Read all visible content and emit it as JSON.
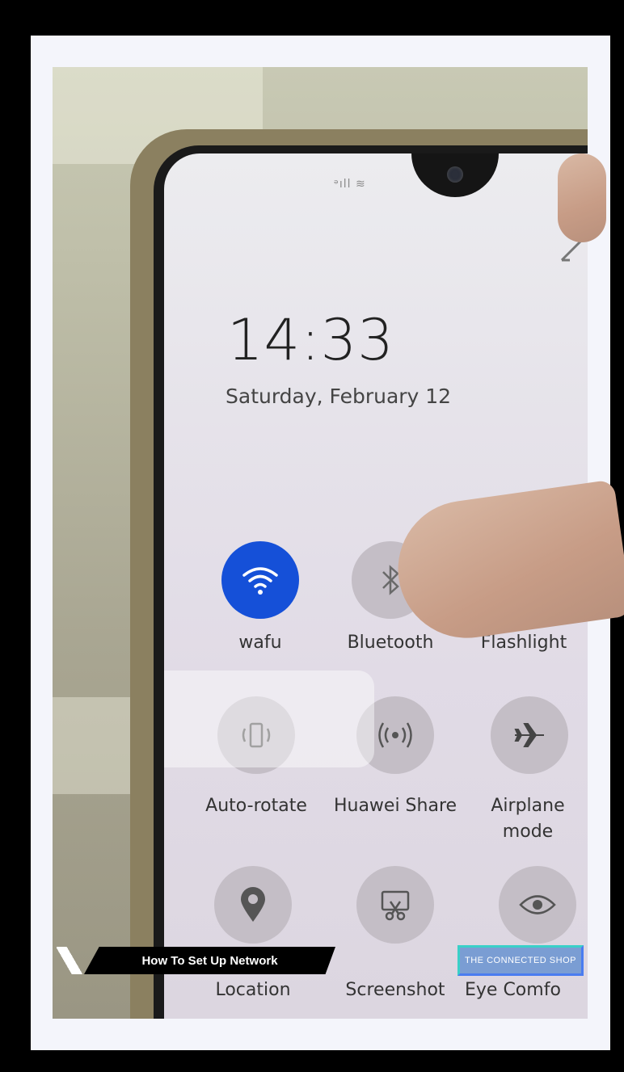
{
  "status_bar": {
    "icons": "ᵊıll ≋"
  },
  "lock_screen": {
    "time": "14:33",
    "date": "Saturday, February 12"
  },
  "quick_settings": {
    "row1": [
      {
        "label": "wafu",
        "icon": "wifi-icon",
        "active": true
      },
      {
        "label": "Bluetooth",
        "icon": "bluetooth-icon",
        "active": false
      },
      {
        "label": "Flashlight",
        "icon": "flashlight-icon",
        "active": false
      }
    ],
    "row2": [
      {
        "label": "Auto-rotate",
        "icon": "auto-rotate-icon",
        "active": false
      },
      {
        "label": "Huawei Share",
        "icon": "huawei-share-icon",
        "active": false
      },
      {
        "label": "Airplane mode",
        "icon": "airplane-icon",
        "active": false
      }
    ],
    "row3": [
      {
        "label": "Location",
        "icon": "location-pin-icon",
        "active": false
      },
      {
        "label": "Screenshot",
        "icon": "screenshot-icon",
        "active": false
      },
      {
        "label": "Eye Comfo",
        "icon": "eye-icon",
        "active": false
      }
    ]
  },
  "overlay": {
    "lower_third_title": "How To Set Up Network",
    "watermark": "THE CONNECTED SHOP"
  },
  "colors": {
    "active_tile": "#1550d8",
    "inactive_tile": "#c4bec6"
  }
}
